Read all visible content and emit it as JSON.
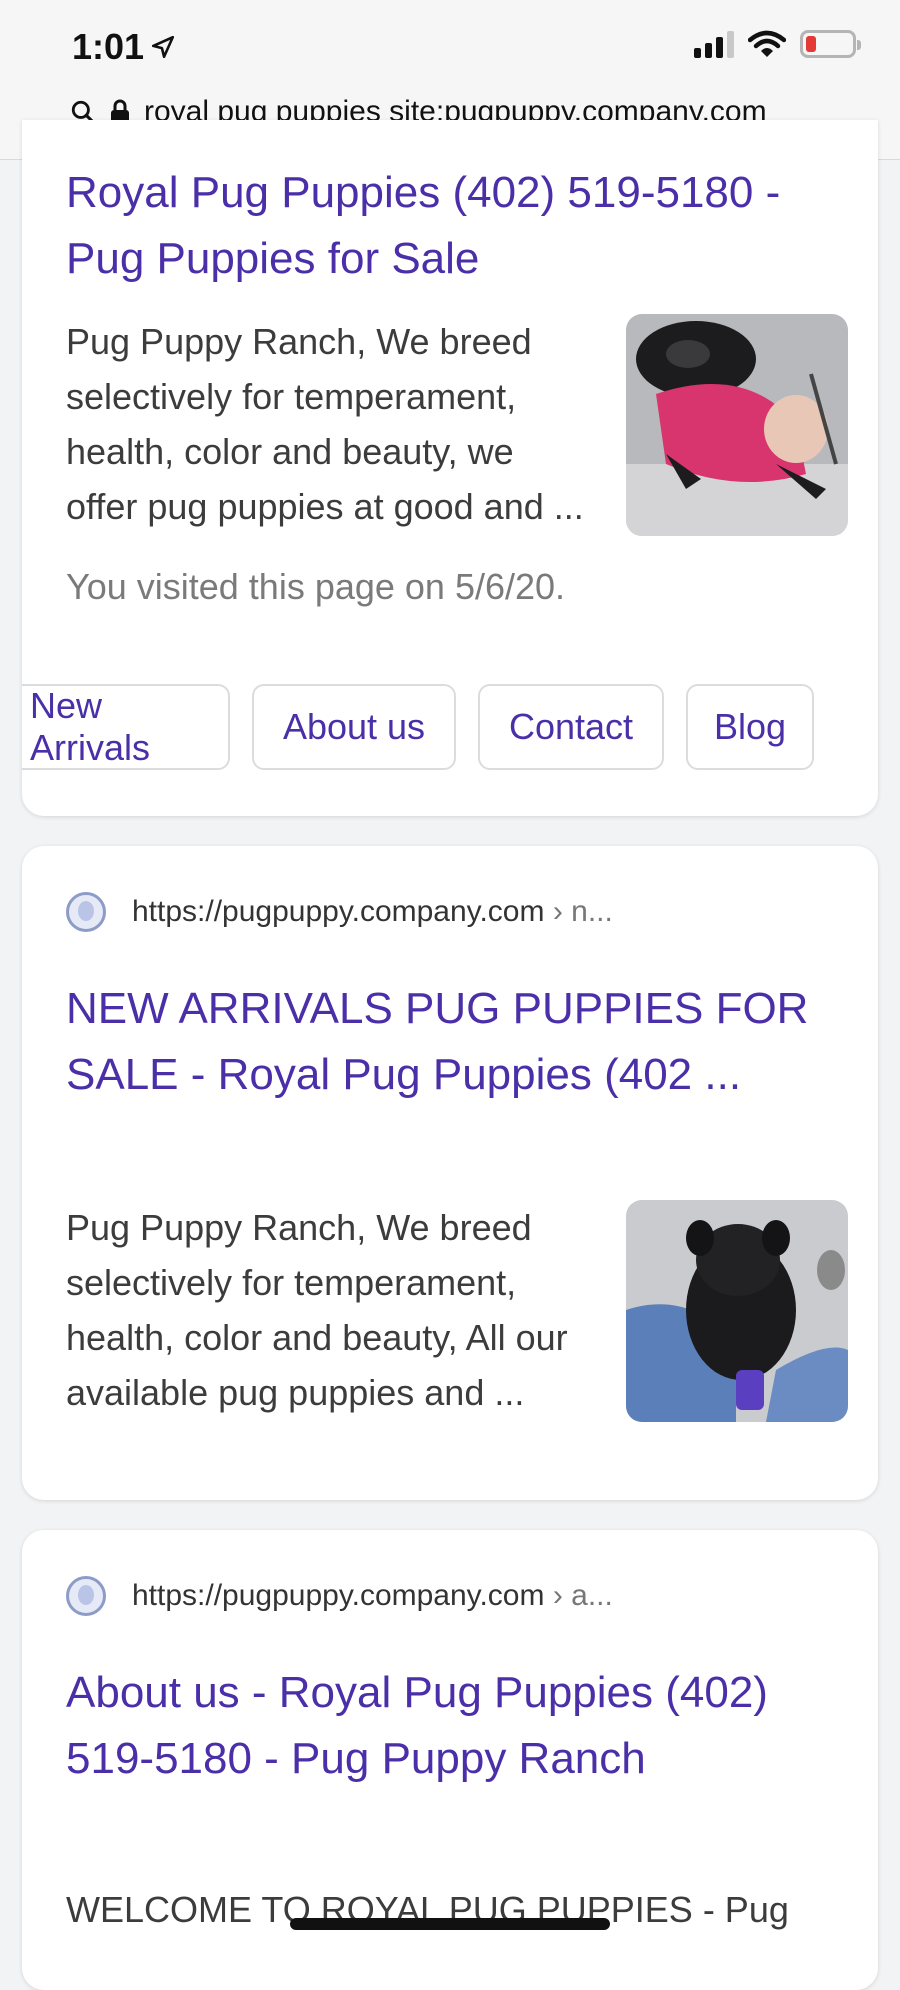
{
  "status": {
    "time": "1:01",
    "battery_color": "#e53935"
  },
  "address_bar": {
    "query": "royal pug puppies site:pugpuppy.company.com"
  },
  "results": [
    {
      "title": "Royal Pug Puppies (402) 519-5180 - Pug Puppies for Sale",
      "snippet": "Pug Puppy Ranch, We breed selectively for temperament, health, color and beauty, we offer pug puppies at good and ...",
      "visited": "You visited this page on 5/6/20.",
      "thumbnail_icon": "pug-in-pink-sweater-image",
      "sitelinks": [
        "New Arrivals",
        "About us",
        "Contact",
        "Blog"
      ]
    },
    {
      "url": "https://pugpuppy.company.com",
      "breadcrumb": "› n...",
      "title": "NEW ARRIVALS PUG PUPPIES FOR SALE - Royal Pug Puppies (402 ...",
      "snippet": "Pug Puppy Ranch, We breed selectively for temperament, health, color and beauty, All our available pug puppies and ...",
      "thumbnail_icon": "black-pug-puppy-image"
    },
    {
      "url": "https://pugpuppy.company.com",
      "breadcrumb": "› a...",
      "title": "About us - Royal Pug Puppies (402) 519-5180 - Pug Puppy Ranch",
      "snippet": "WELCOME TO ROYAL PUG PUPPIES - Pug"
    }
  ],
  "colors": {
    "link": "#4a2fa8",
    "snippet": "#3c3c3c"
  }
}
